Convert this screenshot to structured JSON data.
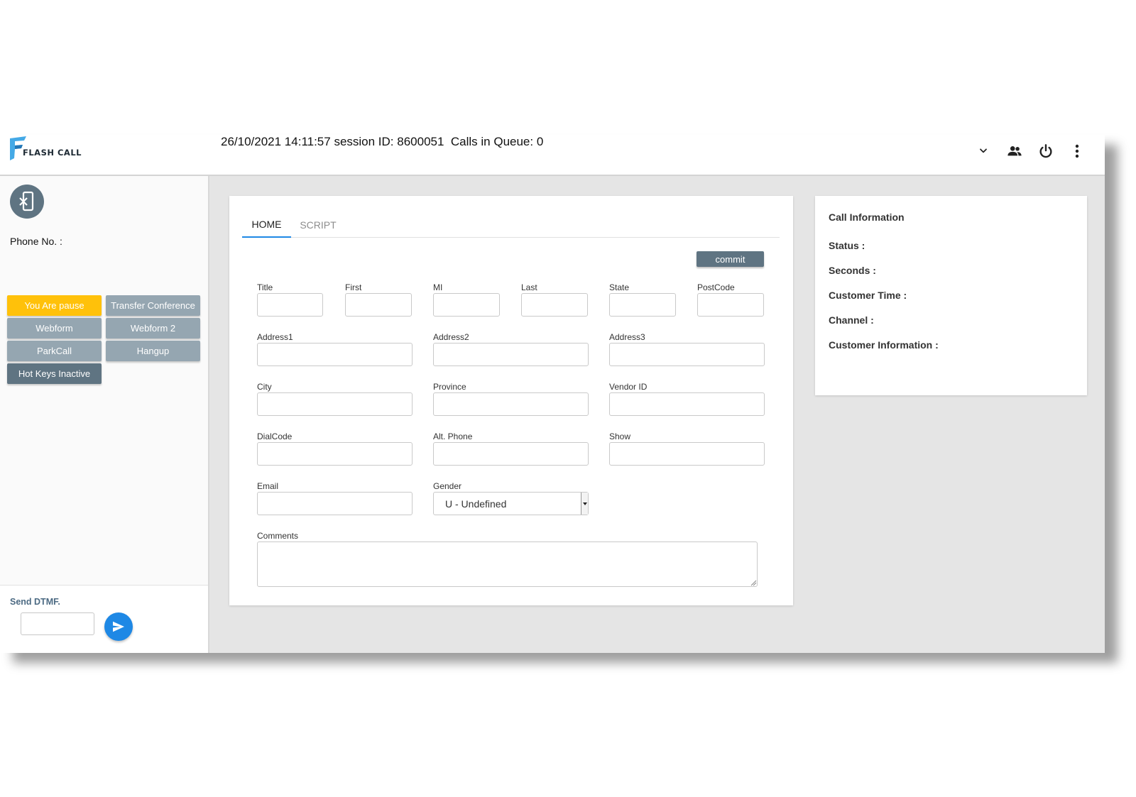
{
  "header": {
    "logo_text": "FLASH CALL",
    "session_text": "26/10/2021 14:11:57 session ID: 8600051  Calls in Queue: 0",
    "icons": [
      "chevron-down-icon",
      "group-icon",
      "power-icon",
      "more-vert-icon"
    ]
  },
  "sidebar": {
    "phone_label": "Phone No. :",
    "buttons": {
      "pause": "You Are pause",
      "transfer": "Transfer Conference",
      "webform": "Webform",
      "webform2": "Webform 2",
      "parkcall": "ParkCall",
      "hangup": "Hangup",
      "hotkeys": "Hot Keys Inactive"
    },
    "dtmf_label": "Send DTMF.",
    "dtmf_value": ""
  },
  "main": {
    "tabs": [
      {
        "label": "HOME",
        "active": true
      },
      {
        "label": "SCRIPT",
        "active": false
      }
    ],
    "commit_label": "commit",
    "fields": {
      "title": {
        "label": "Title",
        "value": ""
      },
      "first": {
        "label": "First",
        "value": ""
      },
      "mi": {
        "label": "MI",
        "value": ""
      },
      "last": {
        "label": "Last",
        "value": ""
      },
      "state": {
        "label": "State",
        "value": ""
      },
      "postcode": {
        "label": "PostCode",
        "value": ""
      },
      "address1": {
        "label": "Address1",
        "value": ""
      },
      "address2": {
        "label": "Address2",
        "value": ""
      },
      "address3": {
        "label": "Address3",
        "value": ""
      },
      "city": {
        "label": "City",
        "value": ""
      },
      "province": {
        "label": "Province",
        "value": ""
      },
      "vendor_id": {
        "label": "Vendor ID",
        "value": ""
      },
      "dialcode": {
        "label": "DialCode",
        "value": ""
      },
      "alt_phone": {
        "label": "Alt. Phone",
        "value": ""
      },
      "show": {
        "label": "Show",
        "value": ""
      },
      "email": {
        "label": "Email",
        "value": ""
      },
      "gender": {
        "label": "Gender",
        "value": "U - Undefined"
      },
      "comments": {
        "label": "Comments",
        "value": ""
      }
    }
  },
  "call_info": {
    "title": "Call Information",
    "status": "Status :",
    "seconds": "Seconds :",
    "customer_time": "Customer Time :",
    "channel": "Channel :",
    "customer_information": "Customer Information :"
  },
  "colors": {
    "accent_blue": "#1e88e5",
    "pause_yellow": "#ffc10a",
    "button_grey": "#95a6b1",
    "button_dark": "#5f7482",
    "background": "#e5e5e5"
  }
}
